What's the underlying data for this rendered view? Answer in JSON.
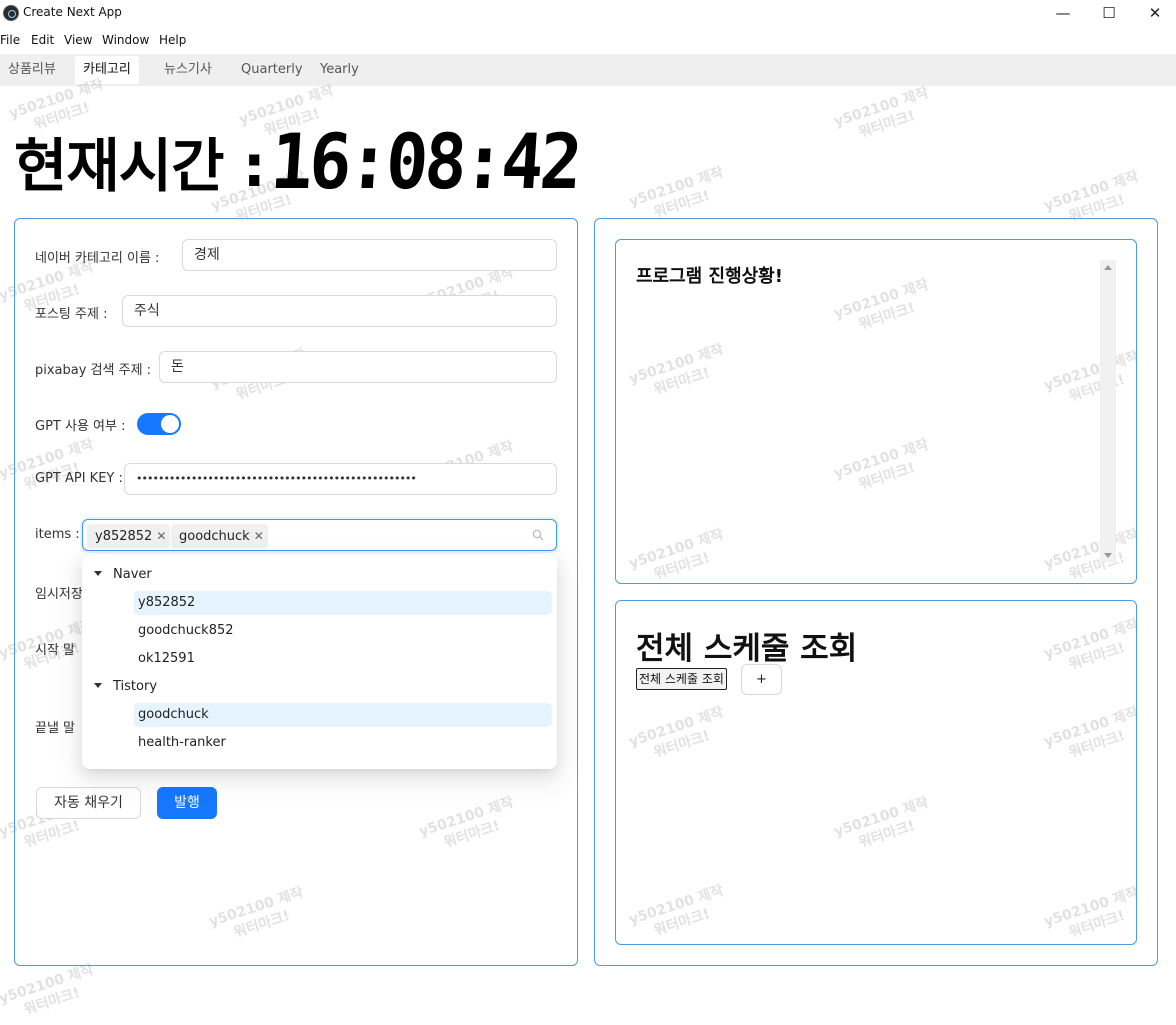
{
  "window": {
    "title": "Create Next App",
    "minimize": "—",
    "maximize": "☐",
    "close": "✕"
  },
  "menu": [
    "File",
    "Edit",
    "View",
    "Window",
    "Help"
  ],
  "tabs": [
    {
      "label": "상품리뷰",
      "active": false
    },
    {
      "label": "카테고리",
      "active": true
    },
    {
      "label": "뉴스기사",
      "active": false
    },
    {
      "label": "Quarterly",
      "active": false
    },
    {
      "label": "Yearly",
      "active": false
    }
  ],
  "watermark": {
    "line1": "y502100 제작",
    "line2": "워터마크!"
  },
  "clock": {
    "label": "현재시간 :",
    "time": "16:08:42"
  },
  "form": {
    "category_label": "네이버 카테고리 이름 :",
    "category_value": "경제",
    "topic_label": "포스팅 주제 :",
    "topic_value": "주식",
    "pixabay_label": "pixabay 검색 주제 :",
    "pixabay_value": "돈",
    "gpt_label": "GPT 사용 여부 :",
    "gpt_enabled": true,
    "apikey_label": "GPT API KEY :",
    "apikey_value": "•••••••••••••••••••••••••••••••••••••••••••••••••••",
    "items_label": "items :",
    "items_tags": [
      "y852852",
      "goodchuck"
    ],
    "temp_label": "임시저장",
    "start_label": "시작 말",
    "end_label": "끝낼 말"
  },
  "dropdown": {
    "groups": [
      {
        "label": "Naver",
        "items": [
          {
            "label": "y852852",
            "selected": true
          },
          {
            "label": "goodchuck852",
            "selected": false
          },
          {
            "label": "ok12591",
            "selected": false
          }
        ]
      },
      {
        "label": "Tistory",
        "items": [
          {
            "label": "goodchuck",
            "selected": true
          },
          {
            "label": "health-ranker",
            "selected": false
          }
        ]
      }
    ]
  },
  "buttons": {
    "autofill": "자동 채우기",
    "publish": "발행"
  },
  "progress": {
    "title": "프로그램 진행상황!"
  },
  "schedule": {
    "title": "전체 스케줄 조회",
    "view_button": "전체 스케줄 조회",
    "add_button": "+"
  },
  "colors": {
    "accent": "#1677ff",
    "panel_border": "#4a9be8",
    "selected_bg": "#e6f4ff"
  }
}
